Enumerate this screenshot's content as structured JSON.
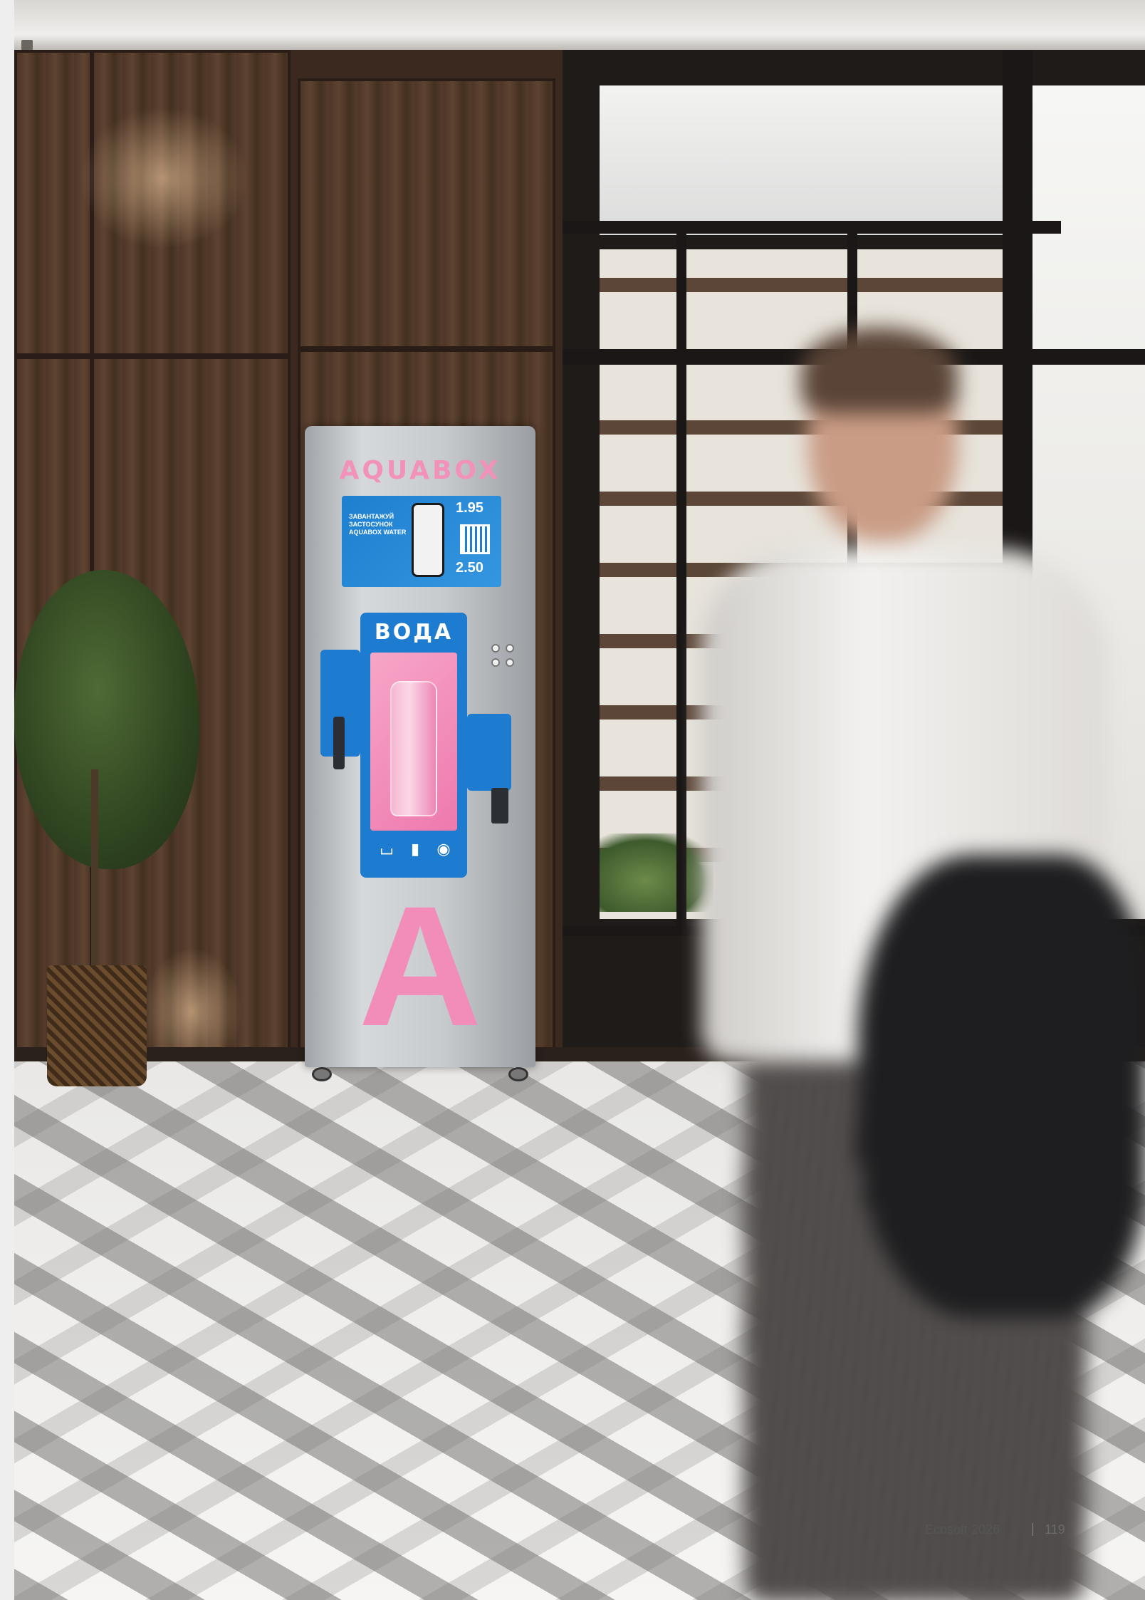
{
  "photo": {
    "kiosk": {
      "brand": "AQUABOX",
      "product_word": "ВОДА",
      "big_letter": "A",
      "screen": {
        "promo_text": "ЗАВАНТАЖУЙ ЗАСТОСУНОК AQUABOX WATER",
        "price_top": "1.95",
        "price_bottom": "2.50"
      }
    }
  },
  "footer": {
    "publication": "Ecosoft 2026",
    "page_number": "119"
  },
  "colors": {
    "kiosk_pink": "#f28dba",
    "kiosk_blue": "#1d7bd0",
    "wall_wood": "#4d3628"
  }
}
